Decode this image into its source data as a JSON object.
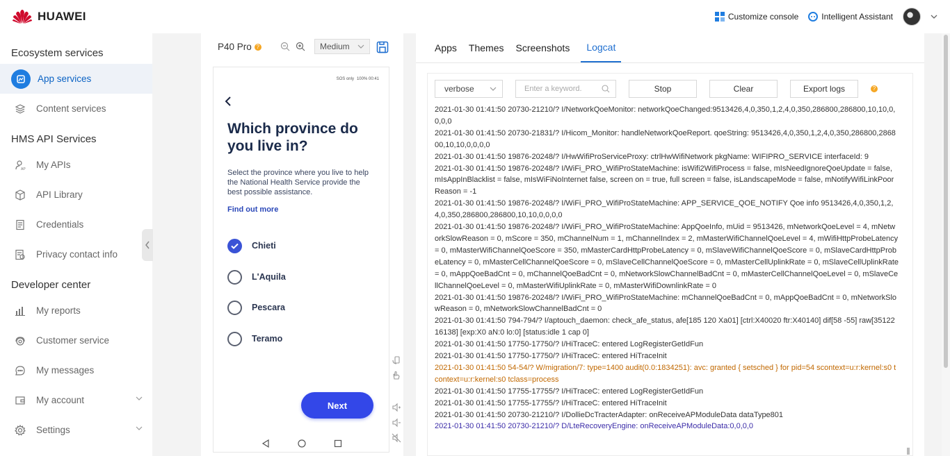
{
  "header": {
    "brand": "HUAWEI",
    "customize": "Customize console",
    "assistant": "Intelligent Assistant"
  },
  "sidebar": {
    "group1": "Ecosystem services",
    "group2": "HMS API Services",
    "group3": "Developer center",
    "items": [
      {
        "label": "App services",
        "icon": "app-services-icon"
      },
      {
        "label": "Content services",
        "icon": "layers-icon"
      },
      {
        "label": "My APIs",
        "icon": "api-user-icon"
      },
      {
        "label": "API Library",
        "icon": "cube-icon"
      },
      {
        "label": "Credentials",
        "icon": "document-icon"
      },
      {
        "label": "Privacy contact info",
        "icon": "privacy-icon"
      },
      {
        "label": "My reports",
        "icon": "bar-chart-icon"
      },
      {
        "label": "Customer service",
        "icon": "headset-icon"
      },
      {
        "label": "My messages",
        "icon": "chat-icon"
      },
      {
        "label": "My account",
        "icon": "wallet-icon"
      },
      {
        "label": "Settings",
        "icon": "gear-icon"
      }
    ]
  },
  "device": {
    "name": "P40 Pro",
    "info_badge": "?",
    "quality": "Medium",
    "status_left": "SOS only",
    "status_right": "100%  00:41"
  },
  "app_screen": {
    "title": "Which province do you live in?",
    "description": "Select the province where you live to help the National Health Service provide the best possible assistance.",
    "link": "Find out more",
    "options": [
      {
        "label": "Chieti",
        "checked": true
      },
      {
        "label": "L'Aquila",
        "checked": false
      },
      {
        "label": "Pescara",
        "checked": false
      },
      {
        "label": "Teramo",
        "checked": false
      }
    ],
    "next": "Next"
  },
  "tabs": [
    "Apps",
    "Themes",
    "Screenshots",
    "Logcat"
  ],
  "active_tab": "Logcat",
  "logcat": {
    "level": "verbose",
    "keyword_placeholder": "Enter a keyword.",
    "stop": "Stop",
    "clear": "Clear",
    "export": "Export logs",
    "help_badge": "?",
    "lines": [
      {
        "text": "2021-01-30 01:41:50 20730-21210/? I/NetworkQoeMonitor: networkQoeChanged:9513426,4,0,350,1,2,4,0,350,286800,286800,10,10,0,0,0,0",
        "level": "i"
      },
      {
        "text": "2021-01-30 01:41:50 20730-21831/? I/Hicom_Monitor: handleNetworkQoeReport. qoeString: 9513426,4,0,350,1,2,4,0,350,286800,286800,10,10,0,0,0,0",
        "level": "i"
      },
      {
        "text": "2021-01-30 01:41:50 19876-20248/? I/HwWifiProServiceProxy: ctrlHwWifiNetwork pkgName: WIFIPRO_SERVICE interfaceId: 9",
        "level": "i"
      },
      {
        "text": "2021-01-30 01:41:50 19876-20248/? I/WiFi_PRO_WifiProStateMachine: isWifi2WifiProcess = false, mIsNeedIgnoreQoeUpdate = false, mIsAppInBlacklist = false, mIsWiFiNoInternet false, screen on = true, full screen = false, isLandscapeMode = false, mNotifyWifiLinkPoorReason = -1",
        "level": "i"
      },
      {
        "text": "2021-01-30 01:41:50 19876-20248/? I/WiFi_PRO_WifiProStateMachine: APP_SERVICE_QOE_NOTIFY Qoe info 9513426,4,0,350,1,2,4,0,350,286800,286800,10,10,0,0,0,0",
        "level": "i"
      },
      {
        "text": "2021-01-30 01:41:50 19876-20248/? I/WiFi_PRO_WifiProStateMachine: AppQoeInfo, mUid = 9513426, mNetworkQoeLevel = 4, mNetworkSlowReason = 0, mScore = 350, mChannelNum = 1, mChannelIndex = 2, mMasterWifiChannelQoeLevel = 4, mWifiHttpProbeLatency = 0, mMasterWifiChannelQoeScore = 350, mMasterCardHttpProbeLatency = 0, mSlaveWifiChannelQoeScore = 0, mSlaveCardHttpProbeLatency = 0, mMasterCellChannelQoeScore = 0, mSlaveCellChannelQoeScore = 0, mMasterCellUplinkRate = 0, mSlaveCellUplinkRate = 0, mAppQoeBadCnt = 0, mChannelQoeBadCnt = 0, mNetworkSlowChannelBadCnt = 0, mMasterCellChannelQoeLevel = 0, mSlaveCellChannelQoeLevel = 0, mMasterWifiUplinkRate = 0, mMasterWifiDownlinkRate = 0",
        "level": "i"
      },
      {
        "text": "2021-01-30 01:41:50 19876-20248/? I/WiFi_PRO_WifiProStateMachine: mChannelQoeBadCnt = 0, mAppQoeBadCnt = 0, mNetworkSlowReason = 0, mNetworkSlowChannelBadCnt = 0",
        "level": "i"
      },
      {
        "text": "2021-01-30 01:41:50 794-794/? I/aptouch_daemon: check_afe_status, afe[185 120 Xa01] [ctrl:X40020 ftr:X40140] dif[58 -55] raw[35122 16138] [exp:X0 aN:0 lo:0] [status:idle 1 cap 0]",
        "level": "i"
      },
      {
        "text": "2021-01-30 01:41:50 17750-17750/? I/HiTraceC: entered LogRegisterGetIdFun",
        "level": "i"
      },
      {
        "text": "2021-01-30 01:41:50 17750-17750/? I/HiTraceC: entered HiTraceInit",
        "level": "i"
      },
      {
        "text": "2021-01-30 01:41:50 54-54/? W/migration/7: type=1400 audit(0.0:1834251): avc: granted { setsched } for pid=54 scontext=u:r:kernel:s0 tcontext=u:r:kernel:s0 tclass=process",
        "level": "w"
      },
      {
        "text": "2021-01-30 01:41:50 17755-17755/? I/HiTraceC: entered LogRegisterGetIdFun",
        "level": "i"
      },
      {
        "text": "2021-01-30 01:41:50 17755-17755/? I/HiTraceC: entered HiTraceInit",
        "level": "i"
      },
      {
        "text": "2021-01-30 01:41:50 20730-21210/? I/DollieDcTracterAdapter: onReceiveAPModuleData dataType801",
        "level": "i"
      },
      {
        "text": "2021-01-30 01:41:50 20730-21210/? D/LteRecoveryEngine: onReceiveAPModuleData:0,0,0,0",
        "level": "d"
      }
    ]
  },
  "colors": {
    "accent": "#1f6fd0",
    "brand_red": "#cf0a2c",
    "next_button": "#3347e8",
    "warn_log": "#c16800",
    "debug_log": "#3b2ca8"
  }
}
